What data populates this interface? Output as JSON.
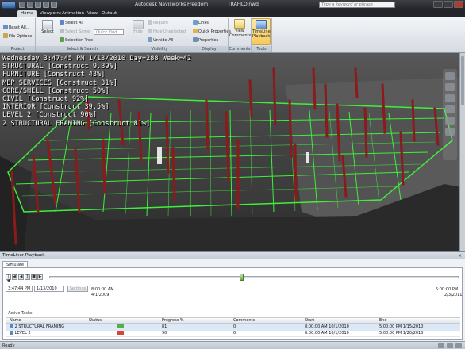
{
  "title_bar": {
    "app_title": "Autodesk Navisworks Freedom",
    "file_name": "TRAFILO.nwd",
    "search_placeholder": "Type a keyword or phrase"
  },
  "tabs": [
    "Home",
    "Viewpoint",
    "Animation",
    "View",
    "Output"
  ],
  "ribbon": {
    "reset_all": "Reset All...",
    "file_options": "File Options",
    "project_group": "Project",
    "select": "Select",
    "select_all": "Select All",
    "select_same": "Select Same",
    "quick_find_placeholder": "Quick Find",
    "selection_tree": "Selection Tree",
    "select_search_group": "Select & Search",
    "hide": "Hide",
    "require": "Require",
    "hide_unselected": "Hide Unselected",
    "unhide_all": "Unhide All",
    "visibility_group": "Visibility",
    "links": "Links",
    "quick_properties": "Quick Properties",
    "properties": "Properties",
    "display_group": "Display",
    "view_comments": "View Comments",
    "comments_group": "Comments",
    "timeliner_playback": "TimeLiner Playback",
    "tools_group": "Tools"
  },
  "overlay": {
    "date_line": "Wednesday 3:47:45 PM 1/13/2010 Day=288 Week=42",
    "lines": [
      "STRUCTURAL [Construct 9.89%]",
      "FURNITURE [Construct 43%]",
      "MEP SERVICES [Construct 31%]",
      "CORE/SHELL [Construct 50%]",
      "CIVIL [Construct 92%]",
      "INTERIOR [Construct 39.5%]",
      "LEVEL 2 [Construct 90%]",
      "2 STRUCTURAL FRAMING [Construct 81%]"
    ]
  },
  "timeliner": {
    "title": "TimeLiner Playback",
    "tab": "Simulate",
    "current_time": "3:47:44 PM",
    "current_date": "1/13/2010",
    "settings": "Settings",
    "start_time": "8:00:00 AM",
    "start_date": "4/1/2009",
    "end_time": "5:00:00 PM",
    "end_date": "2/3/2011",
    "slider_position": 0.47,
    "active_tasks_label": "Active Tasks",
    "columns": [
      "Name",
      "Status",
      "Progress %",
      "Comments",
      "Start",
      "End"
    ],
    "rows": [
      {
        "name": "2 STRUCTURAL FRAMING",
        "progress": "81",
        "comments": "0",
        "start": "8:00:00 AM 10/1/2010",
        "end": "5:00:00 PM 1/15/2010"
      },
      {
        "name": "LEVEL 2",
        "progress": "90",
        "comments": "0",
        "start": "8:00:00 AM 10/1/2010",
        "end": "5:00:00 PM 1/20/2010"
      }
    ]
  },
  "status_bar": {
    "ready": "Ready"
  },
  "colors": {
    "framing_green": "#3ef03a",
    "column_red": "#8b1a1a",
    "ribbon_bg": "#dde2e8",
    "active_tool": "#f7c95a"
  }
}
